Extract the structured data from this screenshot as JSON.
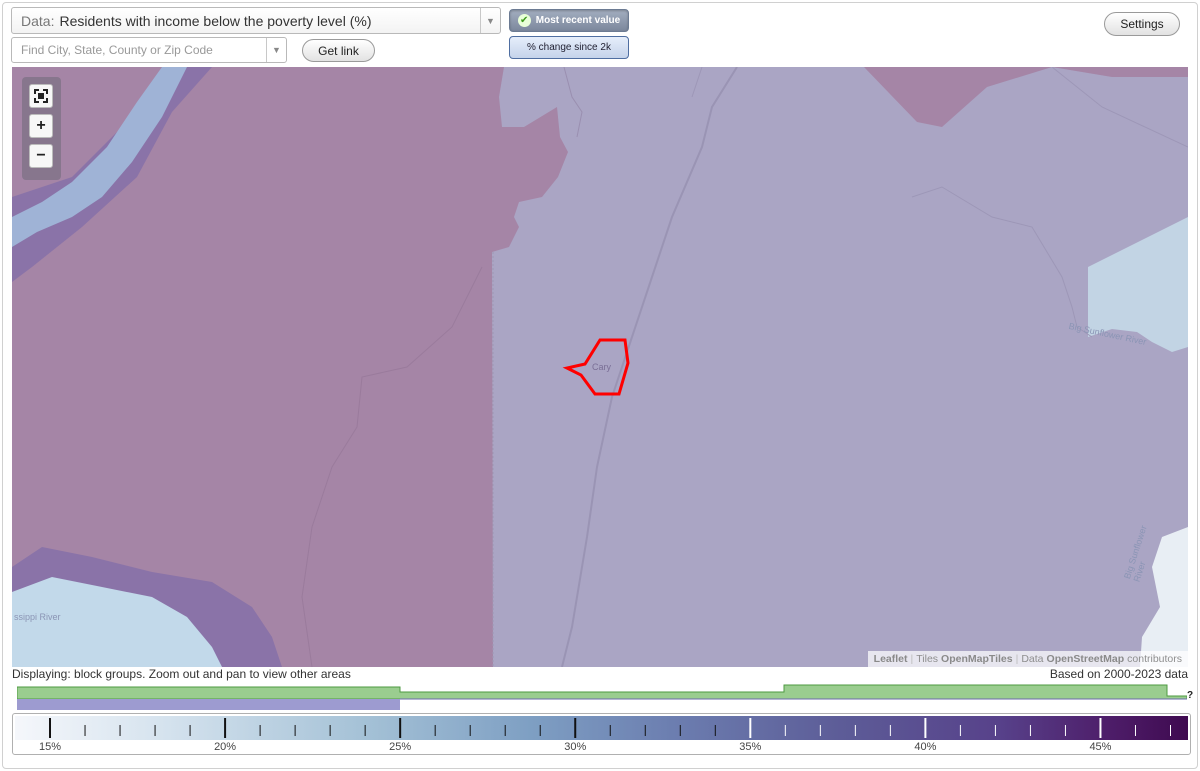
{
  "toolbar": {
    "data_prefix": "Data:",
    "data_value": "Residents with income below the poverty level (%)",
    "most_recent_label": "Most recent value",
    "change_label": "% change since 2k",
    "search_placeholder": "Find City, State, County or Zip Code",
    "get_link_label": "Get link",
    "settings_label": "Settings"
  },
  "map": {
    "place_label": "Cary",
    "river_label_left": "ssippi River",
    "river_label_right": "Big Sunflower River",
    "river_label_right2": "Big Sunflower River",
    "zoom_fullscreen_icon": "fullscreen-icon",
    "zoom_in_symbol": "+",
    "zoom_out_symbol": "−",
    "attribution": {
      "leaflet": "Leaflet",
      "tiles_prefix": "Tiles",
      "tiles": "OpenMapTiles",
      "data_prefix": "Data",
      "data": "OpenStreetMap",
      "suffix": "contributors"
    }
  },
  "footer": {
    "displaying": "Displaying: block groups. Zoom out and pan to view other areas",
    "based_on": "Based on 2000-2023 data",
    "help": "?"
  },
  "legend": {
    "labels": [
      "15%",
      "20%",
      "25%",
      "30%",
      "35%",
      "40%",
      "45%"
    ],
    "min_value": 14.0,
    "max_value": 47.5
  },
  "colors": {
    "map_base": "#aaa5c4",
    "map_high": "#a585a6",
    "river_water": "#bfd6e8",
    "highlight": "#ff0000",
    "timeline_green": "#9acd8f",
    "timeline_blue": "#9d9bd0"
  }
}
